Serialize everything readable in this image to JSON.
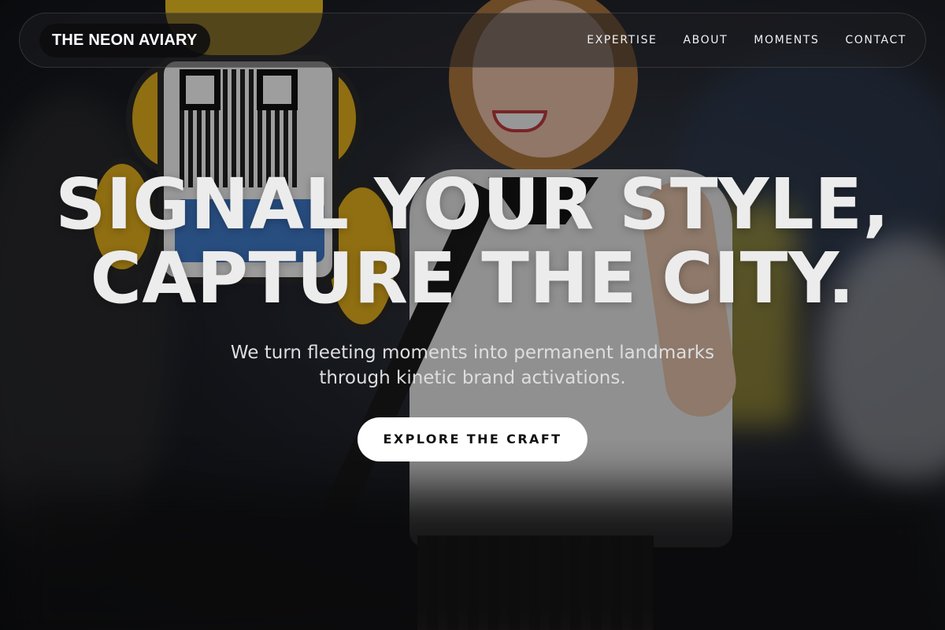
{
  "nav": {
    "brand": "THE NEON AVIARY",
    "items": [
      {
        "label": "EXPERTISE"
      },
      {
        "label": "ABOUT"
      },
      {
        "label": "MOMENTS"
      },
      {
        "label": "CONTACT"
      }
    ]
  },
  "hero": {
    "headline_line1": "SIGNAL YOUR STYLE,",
    "headline_line2": "CAPTURE THE CITY.",
    "subtitle_line1": "We turn fleeting moments into permanent landmarks",
    "subtitle_line2": "through kinetic brand activations.",
    "cta_label": "EXPLORE THE CRAFT"
  },
  "colors": {
    "nav_bg": "#1e1e20",
    "cta_bg": "#ffffff",
    "headline": "#ececec"
  }
}
